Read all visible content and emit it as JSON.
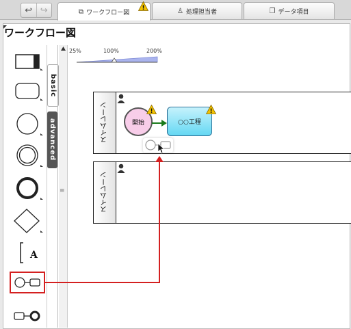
{
  "nav": {
    "back_icon": "undo-icon",
    "forward_icon": "redo-icon"
  },
  "tabs": [
    {
      "label": "ワークフロー図",
      "icon": "workflow-icon"
    },
    {
      "label": "処理担当者",
      "icon": "user-icon"
    },
    {
      "label": "データ項目",
      "icon": "data-item-icon"
    }
  ],
  "title": "ワークフロー図",
  "palette": {
    "tabs": [
      "basic",
      "advanced"
    ],
    "items": [
      "task-shape",
      "rounded-task-shape",
      "start-event-shape",
      "intermediate-event-shape",
      "end-event-shape",
      "gateway-shape",
      "annotation-shape",
      "start-event-connector-shape",
      "end-event-connector-shape"
    ],
    "annotation_glyph": "A",
    "splitter_glyph": "≡"
  },
  "zoom": {
    "labels": [
      "25%",
      "100%",
      "200%"
    ],
    "level_percent": 100
  },
  "lanes": [
    {
      "label": "スイムレーン"
    },
    {
      "label": "スイムレーン"
    }
  ],
  "nodes": {
    "start": "開始",
    "task": "○○工程"
  },
  "colors": {
    "accent_red": "#d42020",
    "task_fill": "#65d8f3",
    "start_fill": "#f8cde9",
    "flow_arrow": "#1a7a1a",
    "warning": "#f2c200"
  }
}
